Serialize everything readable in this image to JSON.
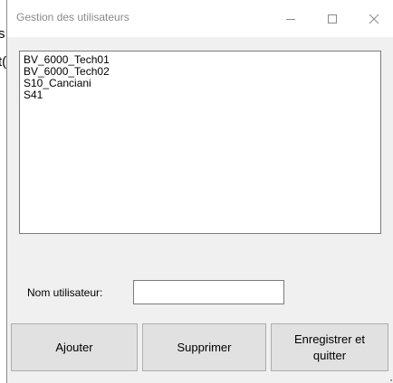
{
  "background": {
    "fragment1": "s",
    "fragment2": "t("
  },
  "window": {
    "title": "Gestion des utilisateurs",
    "controls": {
      "minimize_icon": "minimize-icon",
      "maximize_icon": "maximize-icon",
      "close_icon": "close-icon"
    }
  },
  "users": {
    "items": [
      "BV_6000_Tech01",
      "BV_6000_Tech02",
      "S10_Canciani",
      "S41"
    ]
  },
  "form": {
    "username_label": "Nom utilisateur:",
    "username_value": ""
  },
  "buttons": {
    "add": "Ajouter",
    "delete": "Supprimer",
    "save_quit": "Enregistrer et quitter"
  },
  "colors": {
    "window_bg": "#f0f0f0",
    "titlebar_bg": "#ffffff",
    "button_bg": "#e1e1e1",
    "title_text": "#8a8a8a"
  }
}
